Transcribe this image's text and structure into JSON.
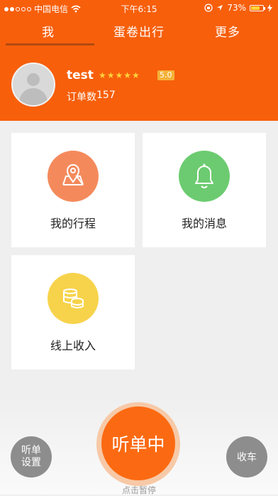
{
  "status_bar": {
    "carrier": "中国电信",
    "time": "下午6:15",
    "battery": "73%",
    "battery_level": 0.73,
    "signal_bars_filled": 2,
    "signal_bars_total": 5,
    "icons": [
      "wifi-icon",
      "orientation-lock-icon",
      "location-icon",
      "battery-icon",
      "charging-icon"
    ]
  },
  "tabs": [
    {
      "label": "我",
      "active": true
    },
    {
      "label": "蛋卷出行",
      "active": false
    },
    {
      "label": "更多",
      "active": false
    }
  ],
  "profile": {
    "username": "test",
    "stars": "★★★★★",
    "rating": "5.0",
    "orders_label": "订单数",
    "orders_count": "157"
  },
  "cards": [
    {
      "label": "我的行程",
      "icon": "map-pin-icon",
      "color": "#f48a5c"
    },
    {
      "label": "我的消息",
      "icon": "bell-icon",
      "color": "#6ccb70"
    },
    {
      "label": "线上收入",
      "icon": "coins-icon",
      "color": "#f7d34b"
    }
  ],
  "bottom": {
    "listen_setting_line1": "听单",
    "listen_setting_line2": "设置",
    "main_button": "听单中",
    "pause_hint": "点击暂停",
    "close_button": "收车"
  },
  "colors": {
    "header": "#f75f0b",
    "main_button": "#fb6a12",
    "star": "#ffd23a",
    "rating_badge": "#f4b23a"
  }
}
